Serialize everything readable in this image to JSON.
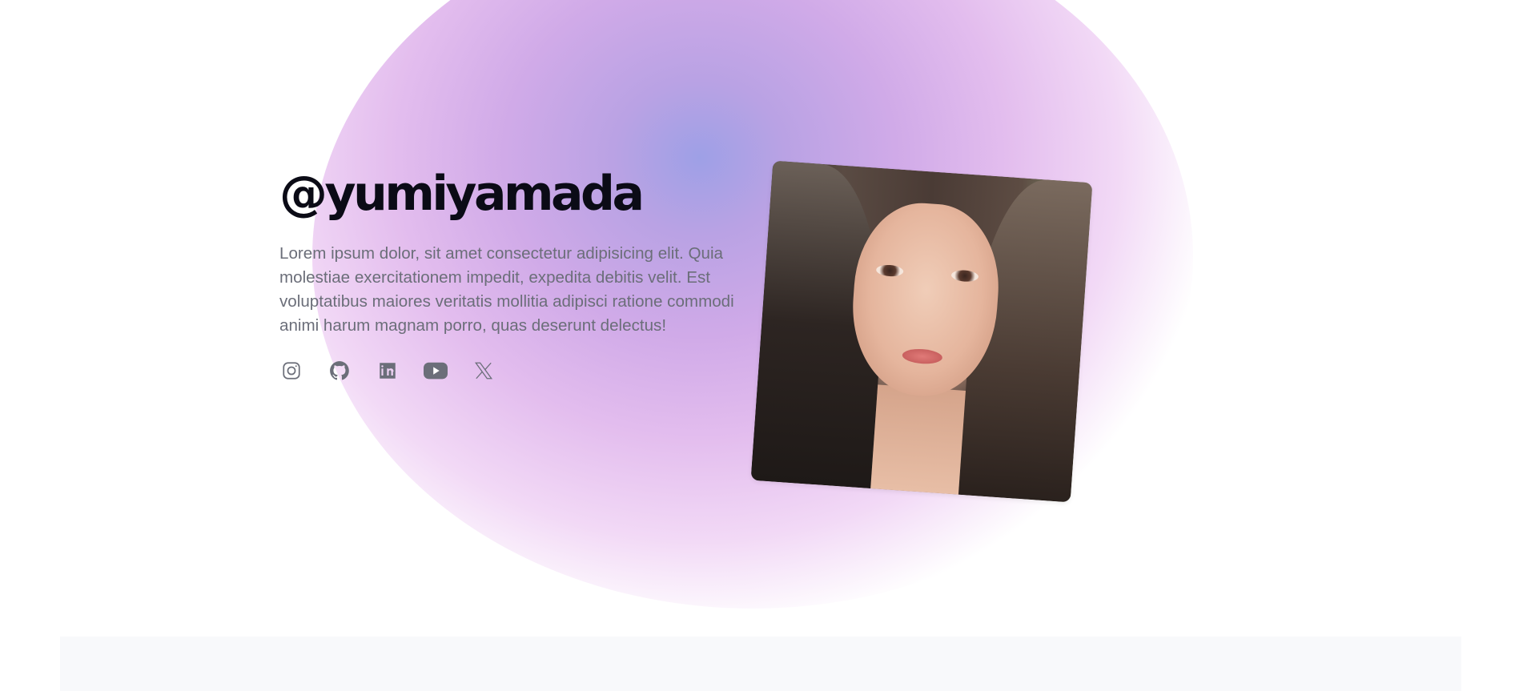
{
  "profile": {
    "handle": "@yumiyamada",
    "bio": "Lorem ipsum dolor, sit amet consectetur adipisicing elit. Quia molestiae exercitationem impedit, expedita debitis velit. Est voluptatibus maiores veritatis mollitia adipisci ratione commodi animi harum magnam porro, quas deserunt delectus!"
  },
  "socials": [
    {
      "icon": "instagram-icon"
    },
    {
      "icon": "github-icon"
    },
    {
      "icon": "linkedin-icon"
    },
    {
      "icon": "youtube-icon"
    },
    {
      "icon": "x-icon"
    }
  ],
  "photo": {
    "icon": "profile-photo"
  },
  "colors": {
    "heading": "#0b0b16",
    "text": "#6b6e79",
    "blob_center": "#9ea0e6",
    "blob_mid": "#d0aae8",
    "footer_band": "#f8f9fb"
  }
}
